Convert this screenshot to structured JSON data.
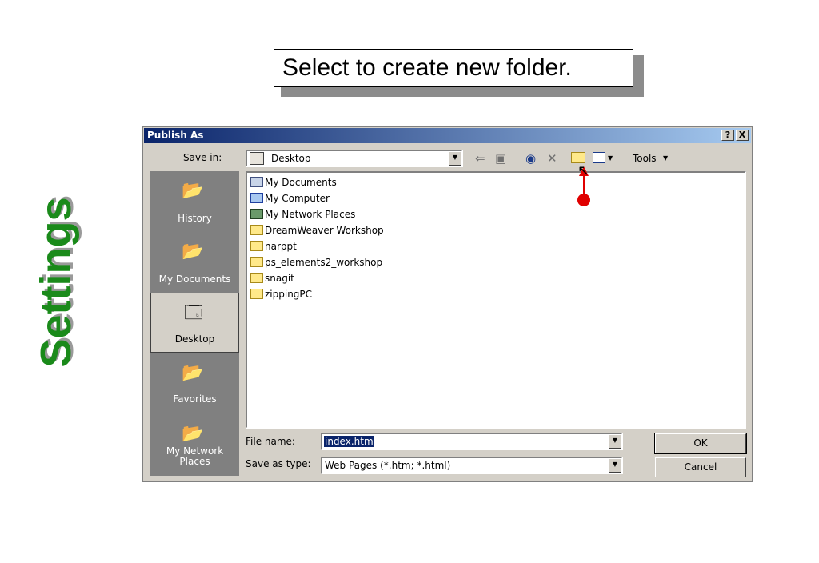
{
  "slide": {
    "side_title": "Settings",
    "callout": "Select to create new folder."
  },
  "dialog": {
    "title": "Publish As",
    "help_button": "?",
    "close_button": "X",
    "save_in_label": "Save in:",
    "save_in_value": "Desktop",
    "tools_label": "Tools",
    "places": [
      {
        "label": "History",
        "icon": "history-icon"
      },
      {
        "label": "My Documents",
        "icon": "my-documents-icon"
      },
      {
        "label": "Desktop",
        "icon": "desktop-icon",
        "selected": true
      },
      {
        "label": "Favorites",
        "icon": "favorites-icon"
      },
      {
        "label": "My Network Places",
        "icon": "network-places-icon"
      }
    ],
    "files": [
      {
        "name": "My Documents",
        "icon": "my-documents-icon"
      },
      {
        "name": "My Computer",
        "icon": "computer-icon"
      },
      {
        "name": "My Network Places",
        "icon": "network-places-icon"
      },
      {
        "name": "DreamWeaver Workshop",
        "icon": "folder-icon"
      },
      {
        "name": "narppt",
        "icon": "folder-icon"
      },
      {
        "name": "ps_elements2_workshop",
        "icon": "folder-icon"
      },
      {
        "name": "snagit",
        "icon": "folder-icon"
      },
      {
        "name": "zippingPC",
        "icon": "folder-icon"
      }
    ],
    "file_name_label": "File name:",
    "file_name_value": "index.htm",
    "save_as_type_label": "Save as type:",
    "save_as_type_value": "Web Pages (*.htm; *.html)",
    "ok_button": "OK",
    "cancel_button": "Cancel"
  },
  "colors": {
    "title_green": "#1a8a1a",
    "pointer_red": "#e00000",
    "titlebar_blue": "#0a246a"
  }
}
